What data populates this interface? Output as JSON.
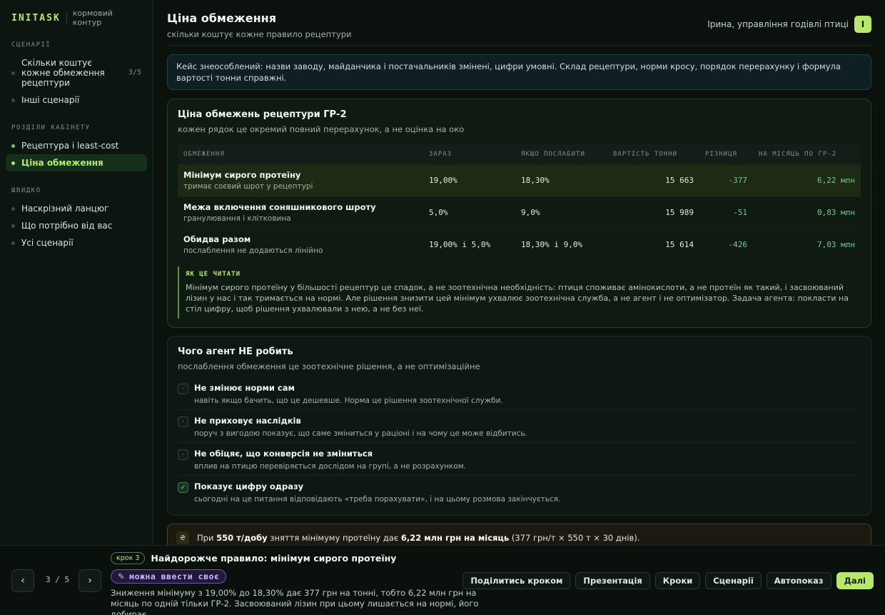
{
  "sidebar": {
    "brand": "INITASK",
    "brand_sub": "кормовий контур",
    "sections": [
      {
        "label": "СЦЕНАРІЇ",
        "items": [
          {
            "label": "Скільки коштує кожне обмеження рецептури",
            "count": "3/5"
          },
          {
            "label": "Інші сценарії"
          }
        ]
      },
      {
        "label": "РОЗДІЛИ КАБІНЕТУ",
        "items": [
          {
            "label": "Рецептура і least-cost"
          },
          {
            "label": "Ціна обмеження"
          }
        ]
      },
      {
        "label": "ШВИДКО",
        "items": [
          {
            "label": "Наскрізний ланцюг"
          },
          {
            "label": "Що потрібно від вас"
          },
          {
            "label": "Усі сценарії"
          }
        ]
      }
    ]
  },
  "header": {
    "title": "Ціна обмеження",
    "subtitle": "скільки коштує кожне правило рецептури",
    "user_name": "Ірина, управління годівлі птиці",
    "avatar": "І"
  },
  "notice": "Кейс знеособлений: назви заводу, майданчика і постачальників змінені, цифри умовні. Склад рецептури, норми кросу, порядок перерахунку і формула вартості тонни справжні.",
  "constraints_card": {
    "title": "Ціна обмежень рецептури ГР-2",
    "subtitle": "кожен рядок це окремий повний перерахунок, а не оцінка на око",
    "columns": [
      "ОБМЕЖЕННЯ",
      "ЗАРАЗ",
      "ЯКЩО ПОСЛАБИТИ",
      "ВАРТІСТЬ ТОННИ",
      "РІЗНИЦЯ",
      "НА МІСЯЦЬ ПО ГР-2"
    ],
    "rows": [
      {
        "name": "Мінімум сирого протеїну",
        "sub": "тримає соєвий шрот у рецептурі",
        "now": "19,00%",
        "relaxed": "18,30%",
        "cost": "15 663",
        "diff": "-377",
        "month": "6,22 млн"
      },
      {
        "name": "Межа включення соняшникового шроту",
        "sub": "гранулювання і клітковина",
        "now": "5,0%",
        "relaxed": "9,0%",
        "cost": "15 989",
        "diff": "-51",
        "month": "0,83 млн"
      },
      {
        "name": "Обидва разом",
        "sub": "послаблення не додаються лінійно",
        "now": "19,00% і 5,0%",
        "relaxed": "18,30% і 9,0%",
        "cost": "15 614",
        "diff": "-426",
        "month": "7,03 млн"
      }
    ],
    "howto_title": "ЯК ЦЕ ЧИТАТИ",
    "howto_text": "Мінімум сирого протеїну у більшості рецептур це спадок, а не зоотехнічна необхідність: птиця споживає амінокислоти, а не протеїн як такий, і засвоюваний лізин у нас і так тримається на нормі. Але рішення знизити цей мінімум ухвалює зоотехнічна служба, а не агент і не оптимізатор. Задача агента: покласти на стіл цифру, щоб рішення ухвалювали з нею, а не без неї."
  },
  "agent_card": {
    "title": "Чого агент НЕ робить",
    "subtitle": "послаблення обмеження це зоотехнічне рішення, а не оптимізаційне",
    "rules": [
      {
        "mark": "·",
        "title": "Не змінює норми сам",
        "sub": "навіть якщо бачить, що це дешевше. Норма це рішення зоотехнічної служби."
      },
      {
        "mark": "·",
        "title": "Не приховує наслідків",
        "sub": "поруч з вигодою показує, що саме зміниться у раціоні і на чому це може відбитись."
      },
      {
        "mark": "·",
        "title": "Не обіцяє, що конверсія не зміниться",
        "sub": "вплив на птицю перевіряється дослідом на групі, а не розрахунком."
      },
      {
        "mark": "✓",
        "title": "Показує цифру одразу",
        "sub": "сьогодні на це питання відповідають «треба порахувати», і на цьому розмова закінчується."
      }
    ]
  },
  "callout": {
    "icon": "₴",
    "pre": "При ",
    "b1": "550 т/добу",
    "mid": " зняття мінімуму протеїну дає ",
    "b2": "6,22 млн грн на місяць",
    "post": " (377 грн/т × 550 т × 30 днів)."
  },
  "bottom": {
    "prev": "‹",
    "next": "›",
    "pager": "3 / 5",
    "step_badge": "крок 3",
    "step_title": "Найдорожче правило: мінімум сирого протеїну",
    "tag_icon": "✎",
    "tag": "можна ввести своє",
    "desc": "Зниження мінімуму з 19,00% до 18,30% дає 377 грн на тонні, тобто 6,22 млн грн на місяць по одній тільки ГР-2. Засвоюваний лізин при цьому лишається на нормі, його добирає...",
    "actions": [
      "Поділитись кроком",
      "Презентація",
      "Кроки",
      "Сценарії",
      "Автопоказ",
      "Далі"
    ]
  },
  "colors": {
    "accent": "#b8e86a",
    "positive": "#6ed08a",
    "background": "#0b120e"
  }
}
